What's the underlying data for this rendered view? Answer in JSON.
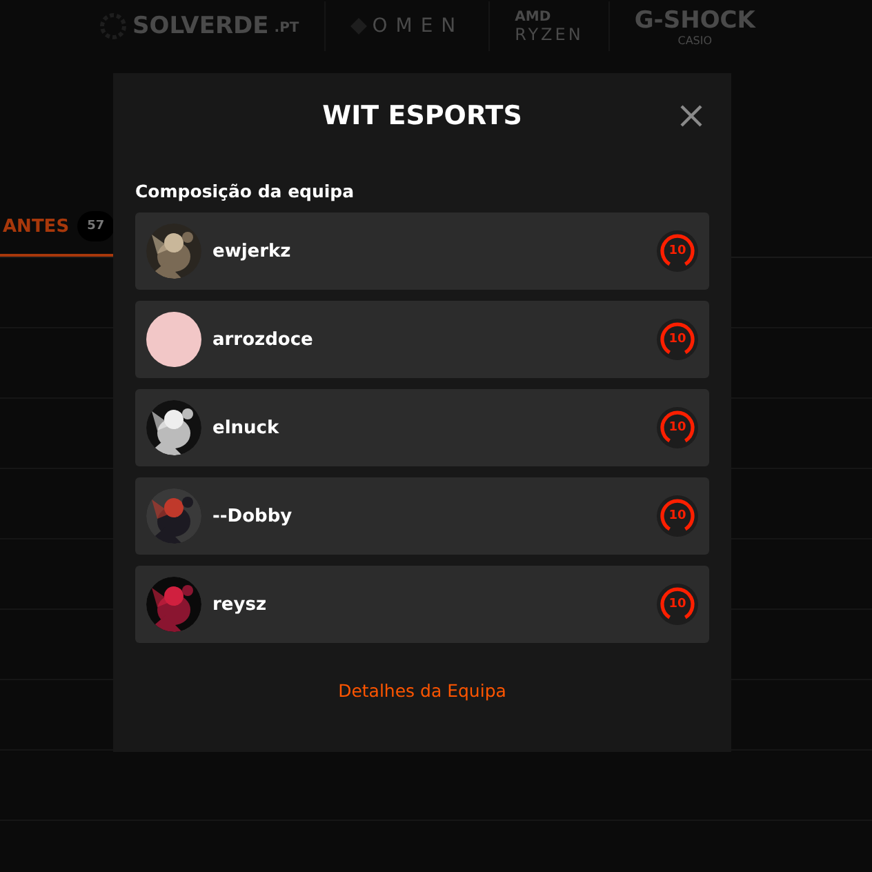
{
  "sponsors": [
    {
      "kind": "solverde",
      "name": "SOLVERDE",
      "suffix": ".PT"
    },
    {
      "kind": "omen",
      "name": "OMEN"
    },
    {
      "kind": "ryzen",
      "name": "AMD",
      "sub": "RYZEN"
    },
    {
      "kind": "gshock",
      "name": "G-SHOCK",
      "sub": "CASIO"
    }
  ],
  "background_tab": {
    "label": "ANTES",
    "count": "57"
  },
  "modal": {
    "title": "WIT ESPORTS",
    "section_title": "Composição da equipa",
    "footer_link": "Detalhes da Equipa"
  },
  "players": [
    {
      "name": "ewjerkz",
      "kind": "picture",
      "level": "10"
    },
    {
      "name": "arrozdoce",
      "kind": "blank",
      "level": "10"
    },
    {
      "name": "elnuck",
      "kind": "picture",
      "level": "10"
    },
    {
      "name": "--Dobby",
      "kind": "picture",
      "level": "10"
    },
    {
      "name": "reysz",
      "kind": "picture",
      "level": "10"
    }
  ]
}
